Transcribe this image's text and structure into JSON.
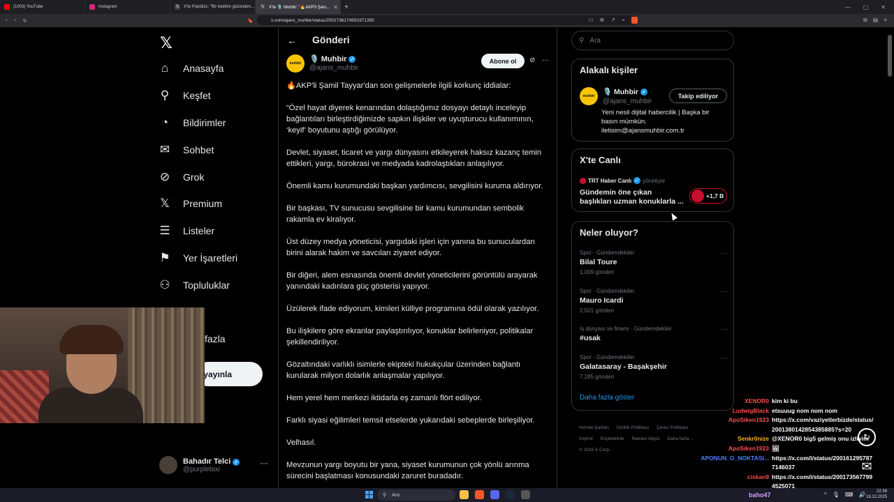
{
  "browser": {
    "tabs": [
      {
        "title": "(1003) YouTube",
        "color": "#ff0000"
      },
      {
        "title": "Instagram",
        "color": "#d62976"
      },
      {
        "title": "X'te Popülizc: \"Bir kedinin gözünden...",
        "color": "#333333"
      },
      {
        "title": "X'te 🎙️ Muhbir: \"🔥AKP'li Şam...",
        "color": "#333333"
      }
    ],
    "url": "x.com/ajans_muhbir/status/2001736174591971350"
  },
  "nav": {
    "items": [
      {
        "label": "Anasayfa",
        "icon": "home-icon",
        "glyph": "⌂"
      },
      {
        "label": "Keşfet",
        "icon": "search-icon",
        "glyph": "⚲"
      },
      {
        "label": "Bildirimler",
        "icon": "bell-icon",
        "glyph": "🔔"
      },
      {
        "label": "Sohbet",
        "icon": "envelope-icon",
        "glyph": "✉"
      },
      {
        "label": "Grok",
        "icon": "grok-icon",
        "glyph": "⊘"
      },
      {
        "label": "Premium",
        "icon": "x-icon",
        "glyph": "𝕏"
      },
      {
        "label": "Listeler",
        "icon": "list-icon",
        "glyph": "☰"
      },
      {
        "label": "Yer İşaretleri",
        "icon": "bookmark-icon",
        "glyph": "🔖"
      },
      {
        "label": "Topluluklar",
        "icon": "people-icon",
        "glyph": "👥"
      }
    ],
    "more_fragment": "fazla",
    "post_fragment": "ri yayınla",
    "profile": {
      "name": "Bahadır Telci",
      "handle": "@purplebixi"
    }
  },
  "main": {
    "title": "Gönderi",
    "author": {
      "name": "🎙️ Muhbir",
      "handle": "@ajans_muhbir",
      "logo_text": "muhbir"
    },
    "subscribe_label": "Abone ol",
    "paragraphs": [
      "🔥AKP'li Şamil Tayyar'dan son gelişmelerle ilgili korkunç iddialar:",
      "“Özel hayat diyerek kenarından dolaştığımız dosyayı detaylı inceleyip bağlantıları birleştirdiğimizde sapkın ilişkiler ve uyuşturucu kullanımının, ‘keyif’ boyutunu aştığı görülüyor.",
      "Devlet, siyaset, ticaret ve yargı dünyasını etkileyerek haksız kazanç temin ettikleri, yargı, bürokrasi ve medyada kadrolaştıkları anlaşılıyor.",
      "Önemli kamu kurumundaki başkan yardımcısı, sevgilisini kuruma aldırıyor.",
      "Bir başkası, TV sunucusu sevgilisine bir kamu kurumundan sembolik rakamla ev kiralıyor.",
      "Üst düzey medya yöneticisi, yargıdaki işleri için yanına bu sunuculardan birini alarak hakim ve savcıları ziyaret ediyor.",
      "Bir diğeri, alem esnasında önemli devlet yöneticilerini görüntülü arayarak yanındaki kadınlara güç gösterisi yapıyor.",
      "Üzülerek ifade ediyorum, kimileri külliye programına ödül olarak yazılıyor.",
      "Bu ilişkilere göre ekranlar paylaştırılıyor, konuklar belirleniyor, politikalar şekillendiriliyor.",
      "Gözaltındaki varlıklı isimlerle ekipteki hukukçular üzerinden bağlantı kurularak milyon dolarlık anlaşmalar yapılıyor.",
      "Hem yerel hem merkezi iktidarla eş zamanlı flört ediliyor.",
      "Farklı siyasi eğilimleri temsil etselerde yukarıdaki sebeplerde birleşiliyor.",
      "Velhasıl.",
      "Mevzunun yargı boyutu bir yana, siyaset kurumunun çok yönlü arınma sürecini başlatması konusundaki zaruret buradadır."
    ]
  },
  "right": {
    "search_placeholder": "Ara",
    "related": {
      "title": "Alakalı kişiler",
      "name": "🎙️ Muhbir",
      "handle": "@ajans_muhbir",
      "follow_label": "Takip ediliyor",
      "bio": "Yeni nesil dijital habercilik | Başka bir basın mümkün. iletisim@ajansmuhbir.com.tr"
    },
    "live": {
      "title": "X'te Canlı",
      "source": "TRT Haber Canlı",
      "role": "yönetiyor",
      "headline": "Gündemin öne çıkan başlıkları uzman konuklarla ...",
      "listeners": "+1,7 B"
    },
    "trends": {
      "title": "Neler oluyor?",
      "items": [
        {
          "category": "Spor · Gündemdekiler",
          "name": "Bilal Toure",
          "count": "1.009 gönderi"
        },
        {
          "category": "Spor · Gündemdekiler",
          "name": "Mauro Icardi",
          "count": "2.501 gönderi"
        },
        {
          "category": "İş dünyası ve finans · Gündemdekiler",
          "name": "#usak",
          "count": ""
        },
        {
          "category": "Spor · Gündemdekiler",
          "name": "Galatasaray - Başakşehir",
          "count": "7.285 gönderi"
        }
      ],
      "show_more": "Daha fazla göster"
    },
    "footer": [
      "Hizmet Şartları",
      "Gizlilik Politikası",
      "Çerez Politikası",
      "Imprint",
      "Erişilebilirlik",
      "Reklam bilgisi",
      "Daha fazla ...",
      "© 2025 X Corp."
    ]
  },
  "chat": [
    {
      "user": "XENOR0",
      "color": "#ff4d4d",
      "msg": "kim ki bu"
    },
    {
      "user": "LudwigBlack",
      "color": "#ff4d4d",
      "msg": "etsuuug nom nom nom"
    },
    {
      "user": "ApoSiken1923",
      "color": "#ff4d4d",
      "msg": "https://x.com/vaziyetlerbizde/status/"
    },
    {
      "user": "",
      "color": "#ff4d4d",
      "msg": "2001380142854385885?s=20"
    },
    {
      "user": "Senkr0nize",
      "color": "#ffb020",
      "msg": "@XENOR0 big5 gelmiş onu izliyim"
    },
    {
      "user": "ApoSiken1923",
      "color": "#ff4d4d",
      "msg": "🖼"
    },
    {
      "user": "APONUN_G_NOKTASI...",
      "color": "#4d7cff",
      "msg": "https://x.com/i/status/200161295787"
    },
    {
      "user": "",
      "color": "#4d7cff",
      "msg": "7146037"
    },
    {
      "user": "ciskan9",
      "color": "#ff4d4d",
      "msg": "https://x.com/i/status/200173567799"
    },
    {
      "user": "",
      "color": "#ff4d4d",
      "msg": "4525071"
    }
  ],
  "taskbar": {
    "search": "Ara",
    "user": "baho47",
    "time": "22:38",
    "date": "18.12.2025"
  }
}
